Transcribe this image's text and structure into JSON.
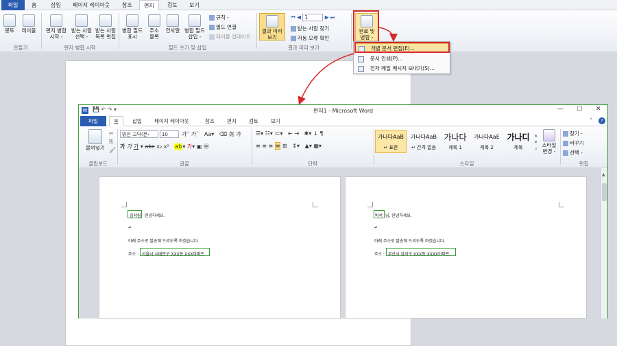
{
  "top": {
    "tabs": [
      "파일",
      "홈",
      "삽입",
      "페이지 레이아웃",
      "참조",
      "편지",
      "검토",
      "보기"
    ],
    "ribbon": {
      "b_envelope": "봉투",
      "b_label": "레이블",
      "b_start_merge": "편지 병합\n시작 -",
      "b_select_recip": "받는 사람\n선택 -",
      "b_edit_recip": "받는 사람\n목록 편집",
      "b_highlight": "병합 필드\n표시",
      "b_address": "주소\n블록",
      "b_greeting": "인사말",
      "b_insert_field": "병합 필드\n삽입 -",
      "s_rules": "규칙 -",
      "s_match": "필드 연결",
      "s_update": "레이블 업데이트",
      "b_preview": "결과 미리\n보기",
      "nav_value": "1",
      "s_find": "받는 사람 찾기",
      "s_check": "자동 오류 확인",
      "b_finish": "완료 및\n병합 -",
      "g_create": "만들기",
      "g_start": "편지 병합 시작",
      "g_fields": "필드 쓰기 및 삽입",
      "g_preview": "결과 미리 보기"
    }
  },
  "menu": {
    "items": [
      "개별 문서 편집(E)...",
      "문서 인쇄(P)...",
      "전자 메일 메시지 보내기(S)..."
    ]
  },
  "win2": {
    "title": "편지1 - Microsoft Word",
    "tabs": [
      "파일",
      "홈",
      "삽입",
      "페이지 레이아웃",
      "참조",
      "편지",
      "검토",
      "보기"
    ],
    "ribbon": {
      "paste": "붙여넣기",
      "font_name": "맑은 고딕(본‹",
      "font_size": "10",
      "g_clipboard": "클립보드",
      "g_font": "글꼴",
      "g_para": "단락",
      "g_style": "스타일",
      "g_edit": "편집",
      "styles": [
        {
          "preview": "가나다AaB",
          "name": "↵ 표준"
        },
        {
          "preview": "가나다AaB",
          "name": "↵ 간격 없음"
        },
        {
          "preview": "가나다",
          "name": "제목 1"
        },
        {
          "preview": "가나다AaE",
          "name": "제목 2"
        },
        {
          "preview": "가나디",
          "name": "제목"
        }
      ],
      "style_change": "스타일\n변경 -",
      "find": "찾기 -",
      "replace": "바꾸기",
      "select": "선택 -"
    },
    "pages": [
      {
        "name": "김서림",
        "greet": "안녕하세요.",
        "line": "아래 주소로 발송해 드리도록 하겠습니다.",
        "addr_label": "주소 :",
        "addr": "서울시 서대문구 XXX동 XXX아파트"
      },
      {
        "name": "박석",
        "greet": "님, 안녕하세요.",
        "line": "아래 주소로 발송해 드리도록 하겠습니다.",
        "addr_label": "주소 :",
        "addr": "부산시 강서구 XXX동 XXXX아파트"
      }
    ]
  }
}
